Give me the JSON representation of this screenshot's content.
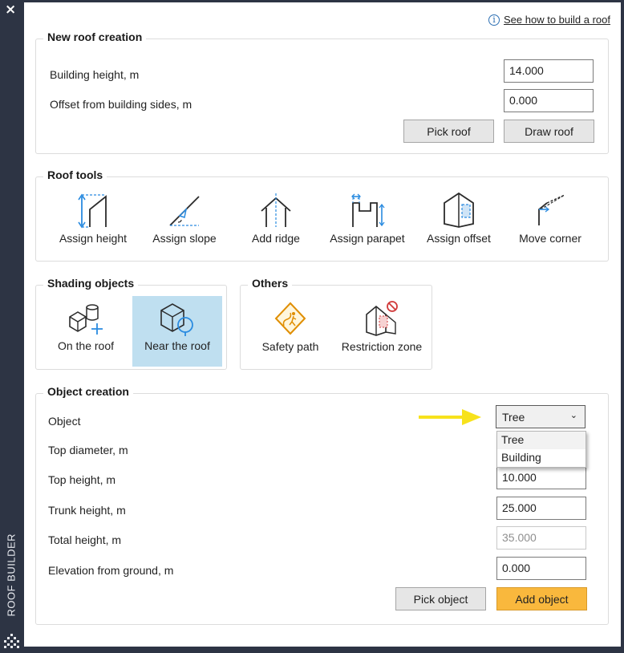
{
  "sidebar": {
    "close_icon": "×",
    "title": "ROOF BUILDER"
  },
  "help": {
    "icon": "i",
    "link_text": "See how to build a roof"
  },
  "new_roof": {
    "title": "New roof creation",
    "building_height_label": "Building height, m",
    "building_height_value": "14.000",
    "offset_label": "Offset from building sides, m",
    "offset_value": "0.000",
    "pick_roof": "Pick roof",
    "draw_roof": "Draw roof"
  },
  "roof_tools": {
    "title": "Roof tools",
    "items": [
      {
        "label": "Assign height",
        "icon": "assign-height-icon"
      },
      {
        "label": "Assign slope",
        "icon": "assign-slope-icon"
      },
      {
        "label": "Add ridge",
        "icon": "add-ridge-icon"
      },
      {
        "label": "Assign parapet",
        "icon": "assign-parapet-icon"
      },
      {
        "label": "Assign offset",
        "icon": "assign-offset-icon"
      },
      {
        "label": "Move corner",
        "icon": "move-corner-icon"
      }
    ]
  },
  "shading": {
    "title": "Shading objects",
    "items": [
      {
        "label": "On the roof",
        "icon": "on-roof-icon",
        "selected": false
      },
      {
        "label": "Near the roof",
        "icon": "near-roof-icon",
        "selected": true
      }
    ]
  },
  "others": {
    "title": "Others",
    "items": [
      {
        "label": "Safety path",
        "icon": "safety-path-icon"
      },
      {
        "label": "Restriction zone",
        "icon": "restriction-zone-icon"
      }
    ]
  },
  "object_creation": {
    "title": "Object creation",
    "object_label": "Object",
    "object_value": "Tree",
    "dropdown_options": [
      "Tree",
      "Building"
    ],
    "top_diameter_label": "Top diameter, m",
    "top_height_label": "Top height, m",
    "top_height_value": "10.000",
    "trunk_height_label": "Trunk height, m",
    "trunk_height_value": "25.000",
    "total_height_label": "Total height, m",
    "total_height_value": "35.000",
    "elevation_label": "Elevation from ground, m",
    "elevation_value": "0.000",
    "pick_object": "Pick object",
    "add_object": "Add object"
  },
  "colors": {
    "accent": "#f9b83d",
    "selected": "#bfdff0",
    "arrow": "#f7e21c",
    "icon_blue": "#2a8be0",
    "sidebar": "#2d3444"
  }
}
